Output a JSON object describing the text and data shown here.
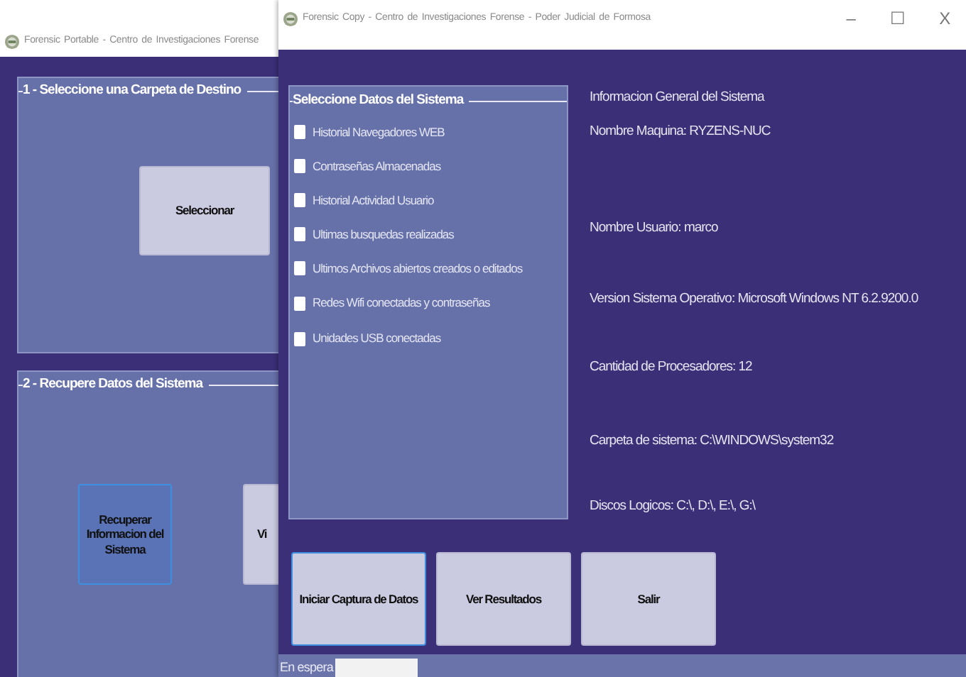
{
  "back_window": {
    "title": "Forensic Portable - Centro de Investigaciones Forense",
    "groups": [
      {
        "title": "1 - Seleccione una Carpeta de Destino",
        "buttons": [
          {
            "label": "Seleccionar",
            "focused": false
          }
        ]
      },
      {
        "title": "2 - Recupere Datos del Sistema",
        "buttons": [
          {
            "label": "Recuperar Informacion del Sistema",
            "focused": true
          },
          {
            "label": "Vi",
            "focused": false
          }
        ]
      }
    ]
  },
  "front_window": {
    "title": "Forensic Copy - Centro de Investigaciones Forense - Poder Judicial de Formosa",
    "controls": [
      "–",
      "☐",
      "X"
    ],
    "data_group": {
      "title": "Seleccione Datos del Sistema",
      "options": [
        {
          "label": "Historial Navegadores WEB",
          "checked": false
        },
        {
          "label": "Contraseñas Almacenadas",
          "checked": false
        },
        {
          "label": "Historial Actividad Usuario",
          "checked": false
        },
        {
          "label": "Ultimas busquedas realizadas",
          "checked": false
        },
        {
          "label": "Ultimos Archivos abiertos creados o editados",
          "checked": false
        },
        {
          "label": "Redes Wifi conectadas y contraseñas",
          "checked": false
        },
        {
          "label": "Unidades USB conectadas",
          "checked": false
        }
      ]
    },
    "info": [
      "Informacion General del Sistema",
      "Nombre Maquina: RYZENS-NUC",
      "Nombre Usuario: marco",
      "Version Sistema Operativo: Microsoft Windows NT 6.2.9200.0",
      "Cantidad de Procesadores: 12",
      "Carpeta de sistema: C:\\WINDOWS\\system32",
      "Discos Logicos: C:\\, D:\\, E:\\, G:\\"
    ],
    "buttons": [
      {
        "label": "Iniciar Captura de Datos",
        "focused": true
      },
      {
        "label": "Ver Resultados",
        "focused": false
      },
      {
        "label": "Salir",
        "focused": false
      }
    ],
    "status_bar": {
      "text": "En espera"
    }
  }
}
